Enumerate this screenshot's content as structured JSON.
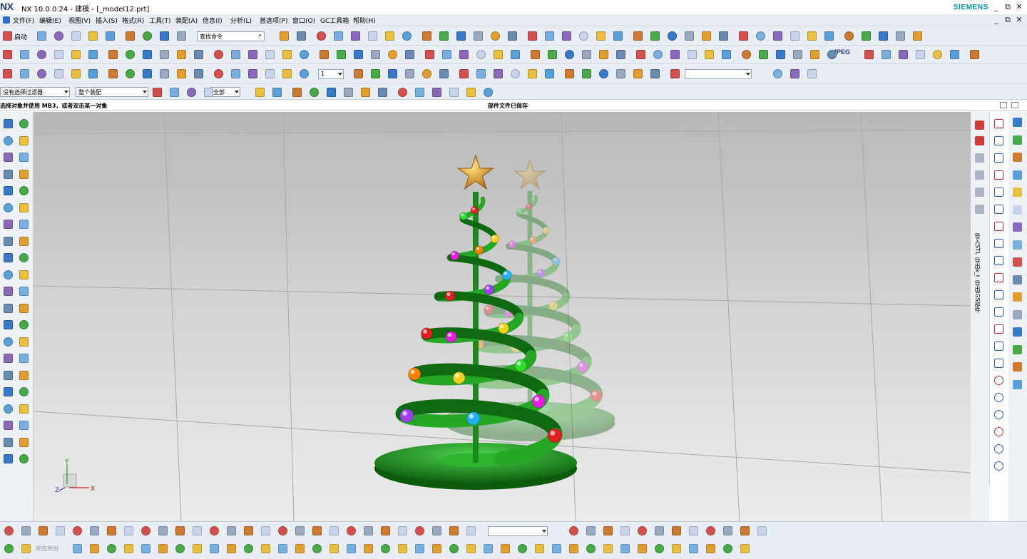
{
  "window": {
    "logo": "NX",
    "title": "NX 10.0.0.24 - 建模 - [_model12.prt]",
    "brand": "SIEMENS",
    "minimize": "_",
    "restore": "⧉",
    "close": "✕"
  },
  "menu": {
    "items": [
      "文件(F)",
      "编辑(E)",
      "视图(V)",
      "插入(S)",
      "格式(R)",
      "工具(T)",
      "装配(A)",
      "信息(I)",
      "分析(L)",
      "首选项(P)",
      "窗口(O)",
      "GC工具箱",
      "帮助(H)"
    ]
  },
  "toolbar": {
    "start_label": "启动",
    "search_placeholder": "查找命令",
    "layer_value": "1",
    "jpeg_label": "JPEG",
    "filter_value": "没有选择过滤器",
    "assembly_value": "整个装配",
    "scope_value": "全部"
  },
  "status": {
    "prompt": "选择对象并使用 MB3，或者双击某一对象",
    "message": "部件文件已保存"
  },
  "side_panel": {
    "labels": [
      "导入STL",
      "导出x_t",
      "导出IGS部件"
    ]
  },
  "bottom": {
    "sketch_label": "完成草图"
  },
  "viewport": {
    "triad_x": "X",
    "triad_y": "Y",
    "triad_z": "Z"
  },
  "colors": {
    "tree_green": "#1e9a1e",
    "star_gold": "#d9a020",
    "viewport_top": "#b8b8b8",
    "viewport_bottom": "#ececec",
    "brand_teal": "#0096a0"
  }
}
